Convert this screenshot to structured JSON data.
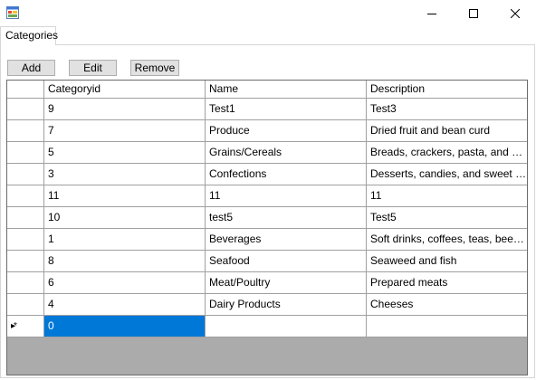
{
  "window": {
    "title": "",
    "icons": {
      "app": "app-form-icon",
      "minimize": "minimize-icon",
      "maximize": "maximize-icon",
      "close": "close-icon"
    }
  },
  "tabs": [
    {
      "label": "Categories"
    }
  ],
  "toolbar": {
    "add_label": "Add",
    "edit_label": "Edit",
    "remove_label": "Remove"
  },
  "grid": {
    "columns": [
      "Categoryid",
      "Name",
      "Description"
    ],
    "rows": [
      {
        "id": "9",
        "name": "Test1",
        "description": "Test3"
      },
      {
        "id": "7",
        "name": "Produce",
        "description": "Dried fruit and bean curd"
      },
      {
        "id": "5",
        "name": "Grains/Cereals",
        "description": "Breads, crackers, pasta, and cereal"
      },
      {
        "id": "3",
        "name": "Confections",
        "description": "Desserts, candies, and sweet bre..."
      },
      {
        "id": "11",
        "name": "11",
        "description": "11"
      },
      {
        "id": "10",
        "name": "test5",
        "description": "Test5"
      },
      {
        "id": "1",
        "name": "Beverages",
        "description": "Soft drinks, coffees, teas, beers, a..."
      },
      {
        "id": "8",
        "name": "Seafood",
        "description": "Seaweed and fish"
      },
      {
        "id": "6",
        "name": "Meat/Poultry",
        "description": "Prepared meats"
      },
      {
        "id": "4",
        "name": "Dairy Products",
        "description": "Cheeses"
      }
    ],
    "new_row": {
      "indicator": "▸*",
      "id": "0",
      "name": "",
      "description": ""
    }
  },
  "colors": {
    "selection": "#0078d7",
    "grid_background": "#ababab",
    "button_face": "#e1e1e1"
  }
}
